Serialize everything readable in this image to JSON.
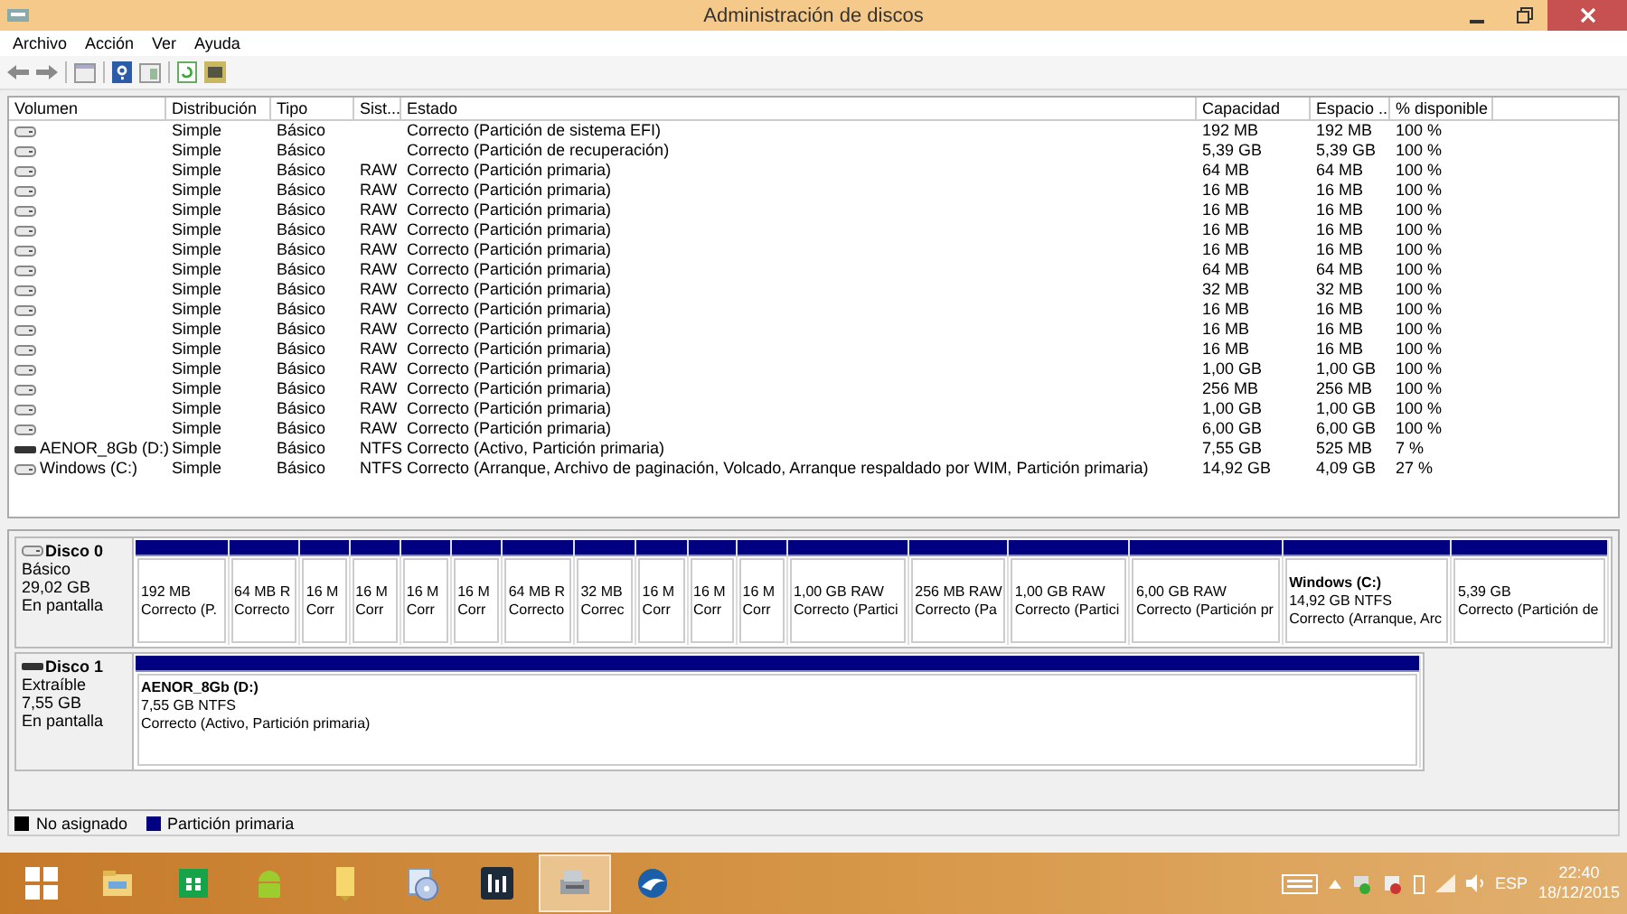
{
  "window": {
    "title": "Administración de discos"
  },
  "menu": [
    "Archivo",
    "Acción",
    "Ver",
    "Ayuda"
  ],
  "table": {
    "columns": [
      "Volumen",
      "Distribución",
      "Tipo",
      "Sist...",
      "Estado",
      "Capacidad",
      "Espacio ...",
      "% disponible"
    ],
    "rows": [
      {
        "kind": "disk",
        "cells": [
          "",
          "Simple",
          "Básico",
          "",
          "Correcto (Partición de sistema EFI)",
          "192 MB",
          "192 MB",
          "100 %"
        ]
      },
      {
        "kind": "disk",
        "cells": [
          "",
          "Simple",
          "Básico",
          "",
          "Correcto (Partición de recuperación)",
          "5,39 GB",
          "5,39 GB",
          "100 %"
        ]
      },
      {
        "kind": "disk",
        "cells": [
          "",
          "Simple",
          "Básico",
          "RAW",
          "Correcto (Partición primaria)",
          "64 MB",
          "64 MB",
          "100 %"
        ]
      },
      {
        "kind": "disk",
        "cells": [
          "",
          "Simple",
          "Básico",
          "RAW",
          "Correcto (Partición primaria)",
          "16 MB",
          "16 MB",
          "100 %"
        ]
      },
      {
        "kind": "disk",
        "cells": [
          "",
          "Simple",
          "Básico",
          "RAW",
          "Correcto (Partición primaria)",
          "16 MB",
          "16 MB",
          "100 %"
        ]
      },
      {
        "kind": "disk",
        "cells": [
          "",
          "Simple",
          "Básico",
          "RAW",
          "Correcto (Partición primaria)",
          "16 MB",
          "16 MB",
          "100 %"
        ]
      },
      {
        "kind": "disk",
        "cells": [
          "",
          "Simple",
          "Básico",
          "RAW",
          "Correcto (Partición primaria)",
          "16 MB",
          "16 MB",
          "100 %"
        ]
      },
      {
        "kind": "disk",
        "cells": [
          "",
          "Simple",
          "Básico",
          "RAW",
          "Correcto (Partición primaria)",
          "64 MB",
          "64 MB",
          "100 %"
        ]
      },
      {
        "kind": "disk",
        "cells": [
          "",
          "Simple",
          "Básico",
          "RAW",
          "Correcto (Partición primaria)",
          "32 MB",
          "32 MB",
          "100 %"
        ]
      },
      {
        "kind": "disk",
        "cells": [
          "",
          "Simple",
          "Básico",
          "RAW",
          "Correcto (Partición primaria)",
          "16 MB",
          "16 MB",
          "100 %"
        ]
      },
      {
        "kind": "disk",
        "cells": [
          "",
          "Simple",
          "Básico",
          "RAW",
          "Correcto (Partición primaria)",
          "16 MB",
          "16 MB",
          "100 %"
        ]
      },
      {
        "kind": "disk",
        "cells": [
          "",
          "Simple",
          "Básico",
          "RAW",
          "Correcto (Partición primaria)",
          "16 MB",
          "16 MB",
          "100 %"
        ]
      },
      {
        "kind": "disk",
        "cells": [
          "",
          "Simple",
          "Básico",
          "RAW",
          "Correcto (Partición primaria)",
          "1,00 GB",
          "1,00 GB",
          "100 %"
        ]
      },
      {
        "kind": "disk",
        "cells": [
          "",
          "Simple",
          "Básico",
          "RAW",
          "Correcto (Partición primaria)",
          "256 MB",
          "256 MB",
          "100 %"
        ]
      },
      {
        "kind": "disk",
        "cells": [
          "",
          "Simple",
          "Básico",
          "RAW",
          "Correcto (Partición primaria)",
          "1,00 GB",
          "1,00 GB",
          "100 %"
        ]
      },
      {
        "kind": "disk",
        "cells": [
          "",
          "Simple",
          "Básico",
          "RAW",
          "Correcto (Partición primaria)",
          "6,00 GB",
          "6,00 GB",
          "100 %"
        ]
      },
      {
        "kind": "removable",
        "cells": [
          "AENOR_8Gb (D:)",
          "Simple",
          "Básico",
          "NTFS",
          "Correcto (Activo, Partición primaria)",
          "7,55 GB",
          "525 MB",
          "7 %"
        ]
      },
      {
        "kind": "disk",
        "cells": [
          "Windows (C:)",
          "Simple",
          "Básico",
          "NTFS",
          "Correcto (Arranque, Archivo de paginación, Volcado, Arranque respaldado por WIM, Partición primaria)",
          "14,92 GB",
          "4,09 GB",
          "27 %"
        ]
      }
    ]
  },
  "disks": [
    {
      "kind": "disk",
      "name": "Disco 0",
      "lines": [
        "Básico",
        "29,02 GB",
        "En pantalla"
      ],
      "partitions": [
        {
          "lines": [
            "192 MB",
            "Correcto (P."
          ]
        },
        {
          "lines": [
            "64 MB R",
            "Correcto"
          ]
        },
        {
          "lines": [
            "16 M",
            "Corr"
          ]
        },
        {
          "lines": [
            "16 M",
            "Corr"
          ]
        },
        {
          "lines": [
            "16 M",
            "Corr"
          ]
        },
        {
          "lines": [
            "16 M",
            "Corr"
          ]
        },
        {
          "lines": [
            "64 MB R",
            "Correcto"
          ]
        },
        {
          "lines": [
            "32 MB",
            "Correc"
          ]
        },
        {
          "lines": [
            "16 M",
            "Corr"
          ]
        },
        {
          "lines": [
            "16 M",
            "Corr"
          ]
        },
        {
          "lines": [
            "16 M",
            "Corr"
          ]
        },
        {
          "lines": [
            "1,00 GB RAW",
            "Correcto (Partici"
          ]
        },
        {
          "lines": [
            "256 MB RAW",
            "Correcto (Pa"
          ]
        },
        {
          "lines": [
            "1,00 GB RAW",
            "Correcto (Partici"
          ]
        },
        {
          "lines": [
            "6,00 GB RAW",
            "Correcto (Partición pr"
          ]
        },
        {
          "name": "Windows  (C:)",
          "lines": [
            "14,92 GB NTFS",
            "Correcto (Arranque, Arc"
          ]
        },
        {
          "lines": [
            "5,39 GB",
            "Correcto (Partición de"
          ]
        }
      ]
    },
    {
      "kind": "removable",
      "name": "Disco 1",
      "lines": [
        "Extraíble",
        "7,55 GB",
        "En pantalla"
      ],
      "partitions": [
        {
          "name": "AENOR_8Gb  (D:)",
          "lines": [
            "7,55 GB NTFS",
            "Correcto (Activo, Partición primaria)"
          ]
        }
      ]
    }
  ],
  "legend": [
    {
      "label": "No asignado",
      "color": "#000000"
    },
    {
      "label": "Partición primaria",
      "color": "#000080"
    }
  ],
  "taskbar": {
    "apps": [
      {
        "selected": false
      },
      {
        "selected": false
      },
      {
        "selected": false
      },
      {
        "selected": false
      },
      {
        "selected": false
      },
      {
        "selected": false
      },
      {
        "selected": true
      },
      {
        "selected": false
      }
    ],
    "language": "ESP",
    "time": "22:40",
    "date": "18/12/2015"
  }
}
